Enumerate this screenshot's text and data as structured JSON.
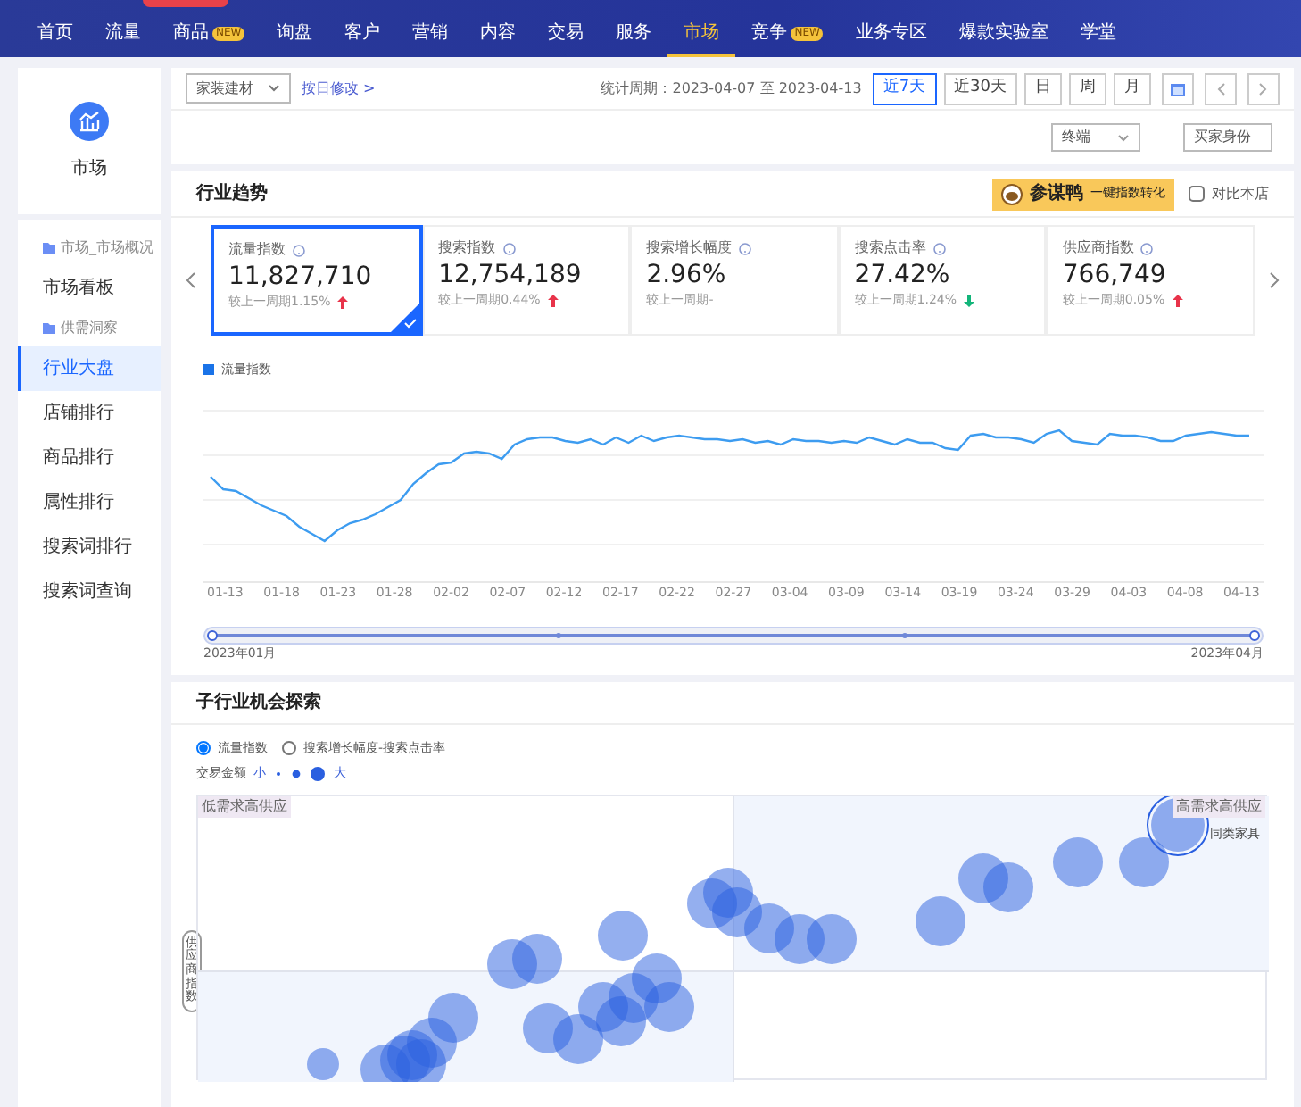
{
  "top_nav": {
    "items": [
      {
        "label": "首页",
        "selected": false
      },
      {
        "label": "流量",
        "selected": false
      },
      {
        "label": "商品",
        "badge": "NEW",
        "selected": false
      },
      {
        "label": "询盘",
        "selected": false
      },
      {
        "label": "客户",
        "selected": false
      },
      {
        "label": "营销",
        "selected": false
      },
      {
        "label": "内容",
        "selected": false
      },
      {
        "label": "交易",
        "selected": false
      },
      {
        "label": "服务",
        "selected": false
      },
      {
        "label": "市场",
        "selected": true
      },
      {
        "label": "竞争",
        "badge": "NEW",
        "selected": false
      },
      {
        "label": "业务专区",
        "selected": false
      },
      {
        "label": "爆款实验室",
        "selected": false
      },
      {
        "label": "学堂",
        "selected": false
      }
    ]
  },
  "sidebar": {
    "title": "市场",
    "items": [
      {
        "kind": "group",
        "label": "市场_市场概况",
        "selected": false
      },
      {
        "kind": "link",
        "label": "市场看板",
        "selected": false
      },
      {
        "kind": "group",
        "label": "供需洞察",
        "selected": false
      },
      {
        "kind": "link",
        "label": "行业大盘",
        "selected": true
      },
      {
        "kind": "link",
        "label": "店铺排行",
        "selected": false
      },
      {
        "kind": "link",
        "label": "商品排行",
        "selected": false
      },
      {
        "kind": "link",
        "label": "属性排行",
        "selected": false
      },
      {
        "kind": "link",
        "label": "搜索词排行",
        "selected": false
      },
      {
        "kind": "link",
        "label": "搜索词查询",
        "selected": false
      }
    ]
  },
  "filter_bar": {
    "category": "家装建材",
    "edit_link": "按日修改 >",
    "period": "统计周期：2023-04-07 至 2023-04-13",
    "range_buttons": [
      {
        "label": "近7天",
        "selected": true
      },
      {
        "label": "近30天",
        "selected": false
      },
      {
        "label": "日",
        "selected": false
      },
      {
        "label": "周",
        "selected": false
      },
      {
        "label": "月",
        "selected": false
      }
    ],
    "dropdowns": [
      "终端",
      "买家身份"
    ]
  },
  "industry_trend": {
    "title": "行业趋势",
    "promo": {
      "brand": "参谋鸭",
      "slogan": "一键指数转化"
    },
    "compare_checkbox": {
      "label": "对比本店",
      "checked": false
    },
    "metrics": [
      {
        "label": "流量指数",
        "value": "11,827,710",
        "compare": "较上一周期1.15%",
        "trend_up": true,
        "trend_down": false,
        "selected": true
      },
      {
        "label": "搜索指数",
        "value": "12,754,189",
        "compare": "较上一周期0.44%",
        "trend_up": true,
        "trend_down": false,
        "selected": false
      },
      {
        "label": "搜索增长幅度",
        "value": "2.96%",
        "compare": "较上一周期-",
        "trend_up": false,
        "trend_down": false,
        "selected": false
      },
      {
        "label": "搜索点击率",
        "value": "27.42%",
        "compare": "较上一周期1.24%",
        "trend_up": false,
        "trend_down": true,
        "selected": false
      },
      {
        "label": "供应商指数",
        "value": "766,749",
        "compare": "较上一周期0.05%",
        "trend_up": true,
        "trend_down": false,
        "selected": false
      }
    ],
    "chart": {
      "legend": "流量指数",
      "x_labels": [
        "01-13",
        "01-18",
        "01-23",
        "01-28",
        "02-02",
        "02-07",
        "02-12",
        "02-17",
        "02-22",
        "02-27",
        "03-04",
        "03-09",
        "03-14",
        "03-19",
        "03-24",
        "03-29",
        "04-03",
        "04-08",
        "04-13"
      ],
      "range_slider": {
        "start": "2023年01月",
        "end": "2023年04月",
        "level": 1
      }
    }
  },
  "sub_industry": {
    "title": "子行业机会探索",
    "radios": [
      {
        "label": "流量指数",
        "selected": true
      },
      {
        "label": "搜索增长幅度-搜索点击率",
        "selected": false
      }
    ],
    "size_legend": {
      "label": "交易金额",
      "small": "小",
      "large": "大"
    },
    "quadrant_left": "低需求高供应",
    "quadrant_right": "高需求高供应",
    "highlight_bubble": "同类家具",
    "y_axis": "供应商指数"
  }
}
